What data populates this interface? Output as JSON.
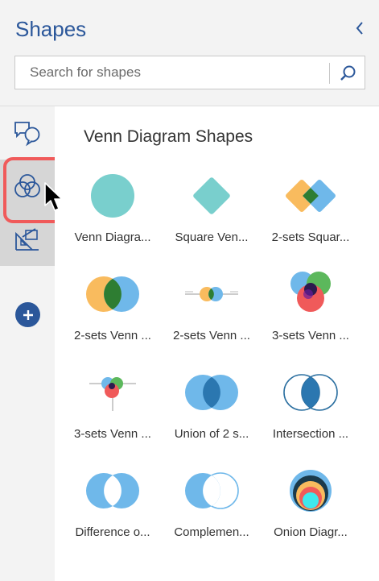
{
  "panel": {
    "title": "Shapes",
    "collapse_icon": "chevron-left-icon"
  },
  "search": {
    "placeholder": "Search for shapes",
    "icon": "search-icon"
  },
  "rail": {
    "items": [
      {
        "icon": "speech-bubbles-icon",
        "selected": false
      },
      {
        "icon": "venn-icon",
        "selected": true
      },
      {
        "icon": "drafting-tools-icon",
        "selected": false
      }
    ],
    "add_icon": "plus-icon"
  },
  "section": {
    "title": "Venn Diagram Shapes"
  },
  "shapes": [
    {
      "label": "Venn Diagra..."
    },
    {
      "label": "Square Ven..."
    },
    {
      "label": "2-sets Squar..."
    },
    {
      "label": "2-sets Venn ..."
    },
    {
      "label": "2-sets Venn ..."
    },
    {
      "label": "3-sets Venn ..."
    },
    {
      "label": "3-sets Venn ..."
    },
    {
      "label": "Union of 2 s..."
    },
    {
      "label": "Intersection ..."
    },
    {
      "label": "Difference o..."
    },
    {
      "label": "Complemen..."
    },
    {
      "label": "Onion Diagr..."
    }
  ],
  "colors": {
    "accent": "#2b579a",
    "teal": "#79cfcd",
    "blue": "#6fb8ea",
    "orange": "#f9bb5e",
    "green": "#2e7d32",
    "highlight": "#f05a5a"
  }
}
